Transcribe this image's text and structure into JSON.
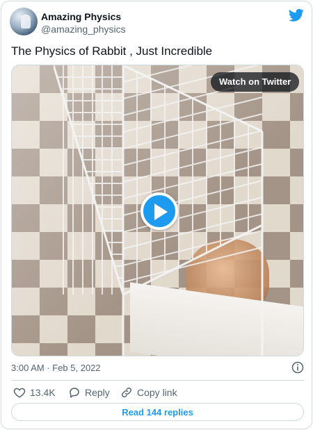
{
  "author": {
    "name": "Amazing Physics",
    "handle": "@amazing_physics"
  },
  "tweet": {
    "text": "The Physics of Rabbit , Just Incredible"
  },
  "media": {
    "watch_label": "Watch on Twitter",
    "play_icon": "play-icon"
  },
  "meta": {
    "timestamp": "3:00 AM · Feb 5, 2022"
  },
  "actions": {
    "likes": "13.4K",
    "reply_label": "Reply",
    "copy_link_label": "Copy link"
  },
  "footer": {
    "read_replies_label": "Read 144 replies"
  },
  "colors": {
    "accent": "#1d9bf0",
    "text": "#0f1419",
    "muted": "#536471",
    "border": "#cfd9de"
  }
}
